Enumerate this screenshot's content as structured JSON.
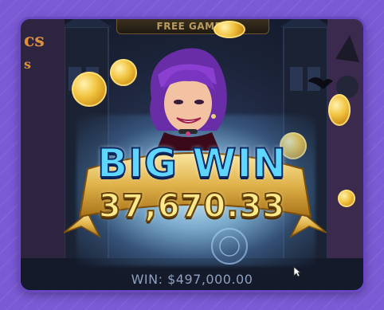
{
  "game": {
    "top_banner": "FREE GAMES",
    "headline": "BIG WIN",
    "win_amount": "37,670.33",
    "total_win": "WIN: $497,000.00"
  },
  "colors": {
    "page_bg": "#7b5ad6",
    "headline": "#5fd6ff",
    "amount": "#ffe98a",
    "ribbon_gold": "#e0b24a"
  }
}
